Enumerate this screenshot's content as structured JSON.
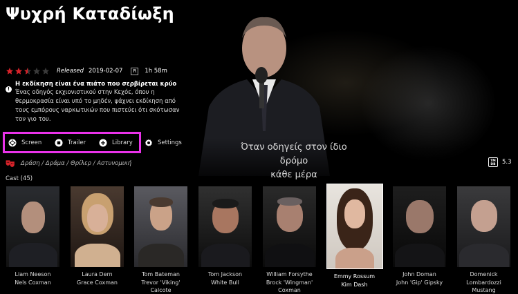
{
  "movie": {
    "title": "Ψυχρή Καταδίωξη",
    "stars": {
      "filled": 2,
      "half": 1,
      "total": 5
    },
    "released_label": "Released",
    "release_date": "2019-02-07",
    "rating_badge": "R",
    "runtime": "1h 58m",
    "tagline": "Η εκδίκηση είναι ένα πιάτο που σερβίρεται κρύο",
    "plot": "Ένας οδηγός εκχιονιστικού στην Κεχόε, όπου η θερμοκρασία είναι υπό το μηδέν, ψάχνει εκδίκηση από τους εμπόρους ναρκωτικών που πιστεύει ότι σκότωσαν τον γιο του.",
    "genres": "Δράση / Δράμα / Θρίλερ / Αστυνομική",
    "tmdb_logo": "TM\nDB",
    "tmdb_score": "5.3",
    "backdrop_subtitle_line1": "Όταν οδηγείς στον ίδιο δρόμο",
    "backdrop_subtitle_line2": "κάθε μέρα"
  },
  "actions": {
    "screen": "Screen",
    "trailer": "Trailer",
    "library": "Library",
    "settings": "Settings"
  },
  "cast_label": "Cast (45)",
  "cast": [
    {
      "name": "Liam Neeson",
      "role": "Nels Coxman",
      "role2": ""
    },
    {
      "name": "Laura Dern",
      "role": "Grace Coxman",
      "role2": ""
    },
    {
      "name": "Tom Bateman",
      "role": "Trevor 'Viking'",
      "role2": "Calcote"
    },
    {
      "name": "Tom Jackson",
      "role": "White Bull",
      "role2": ""
    },
    {
      "name": "William Forsythe",
      "role": "Brock 'Wingman'",
      "role2": "Coxman"
    },
    {
      "name": "Emmy Rossum",
      "role": "Kim Dash",
      "role2": ""
    },
    {
      "name": "John Doman",
      "role": "John 'Gip' Gipsky",
      "role2": ""
    },
    {
      "name": "Domenick",
      "role": "Lombardozzi",
      "role2": "Mustang"
    }
  ],
  "colors": {
    "highlight": "#ea32ea",
    "star": "#d8232a",
    "genre_icon": "#d8232a"
  }
}
